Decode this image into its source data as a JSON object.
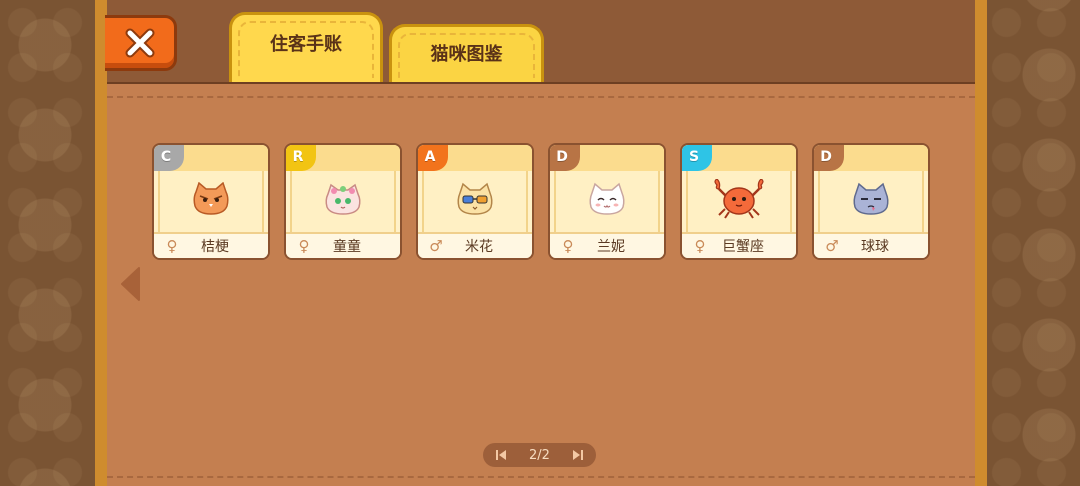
{
  "tabs": [
    {
      "label": "住客手账",
      "active": true
    },
    {
      "label": "猫咪图鉴",
      "active": false
    }
  ],
  "cats": [
    {
      "rarity": "C",
      "rarity_color": "#a8a8a8",
      "gender": "female",
      "gender_symbol": "♀",
      "name": "桔梗",
      "icon": "orange-owl-cat-icon",
      "face_color": "#f39a58"
    },
    {
      "rarity": "R",
      "rarity_color": "#f2c413",
      "gender": "female",
      "gender_symbol": "♀",
      "name": "童童",
      "icon": "flower-crown-cat-icon",
      "face_color": "#fbe3e0"
    },
    {
      "rarity": "A",
      "rarity_color": "#f2731c",
      "gender": "male",
      "gender_symbol": "♂",
      "name": "米花",
      "icon": "sunglasses-cat-icon",
      "face_color": "#fbe2a6"
    },
    {
      "rarity": "D",
      "rarity_color": "#b87445",
      "gender": "female",
      "gender_symbol": "♀",
      "name": "兰妮",
      "icon": "white-cat-icon",
      "face_color": "#ffffff"
    },
    {
      "rarity": "S",
      "rarity_color": "#2ec4e6",
      "gender": "female",
      "gender_symbol": "♀",
      "name": "巨蟹座",
      "icon": "crab-cat-icon",
      "face_color": "#f46a3a"
    },
    {
      "rarity": "D",
      "rarity_color": "#b87445",
      "gender": "male",
      "gender_symbol": "♂",
      "name": "球球",
      "icon": "grey-cat-icon",
      "face_color": "#aab3d6"
    }
  ],
  "pager": {
    "text": "2/2"
  }
}
